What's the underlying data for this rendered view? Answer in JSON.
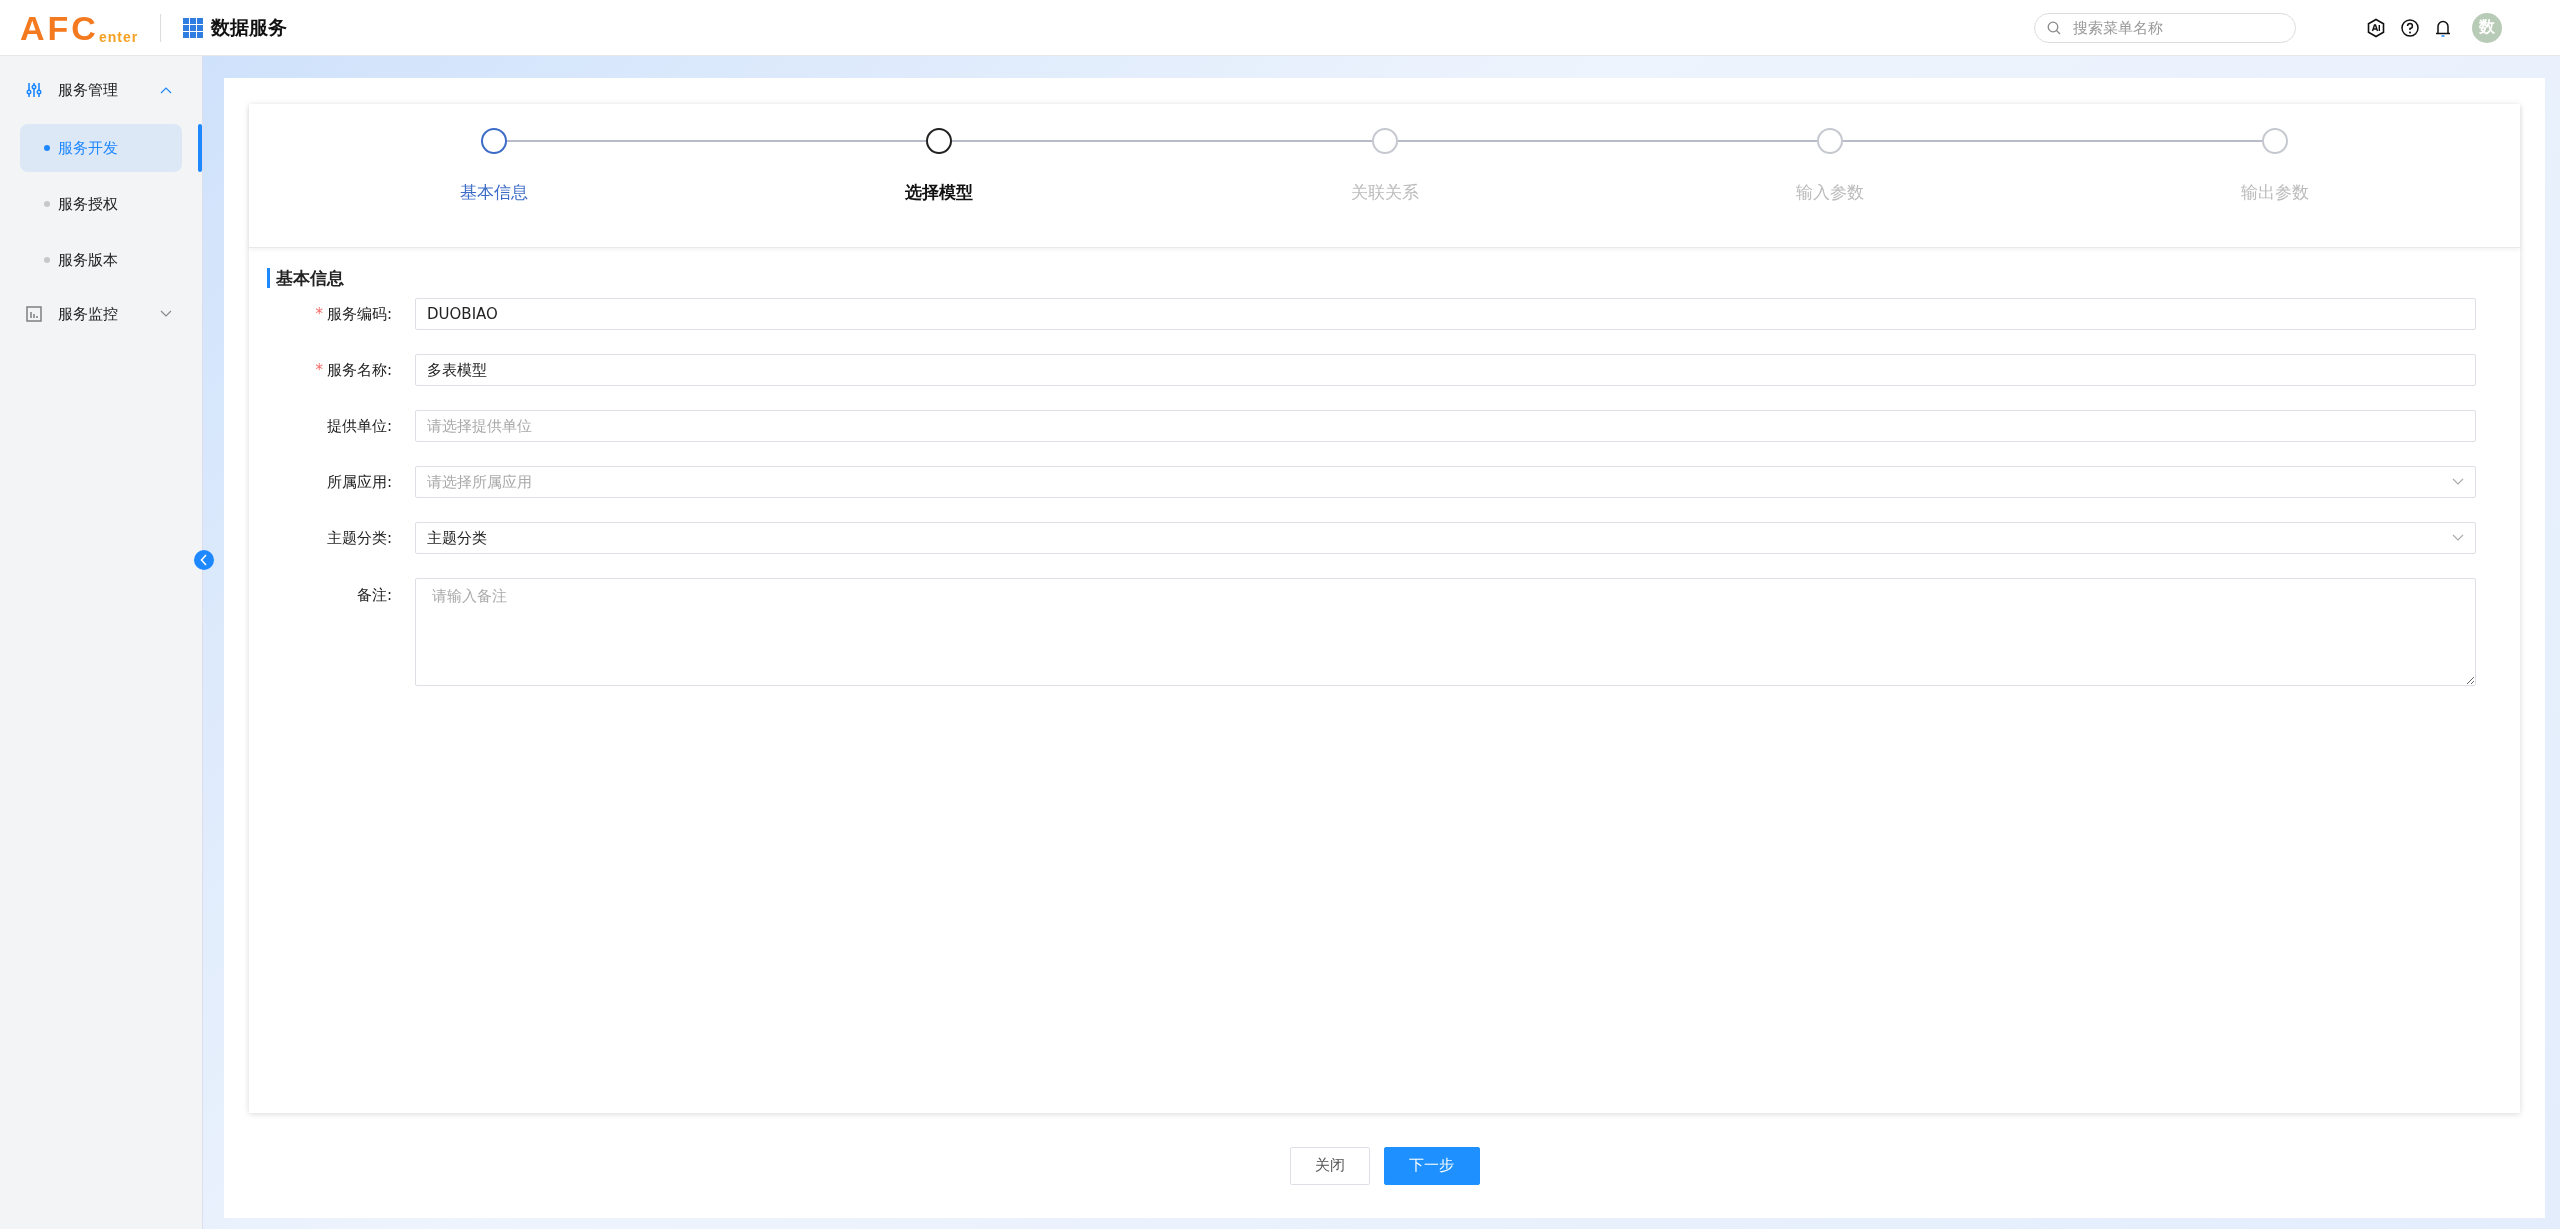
{
  "header": {
    "logo_main": "AFC",
    "logo_sub": "enter",
    "app_title": "数据服务",
    "search": {
      "placeholder": "搜索菜单名称"
    },
    "avatar": "数"
  },
  "sidebar": {
    "groups": [
      {
        "label": "服务管理",
        "expanded": true,
        "children": [
          {
            "label": "服务开发",
            "selected": true
          },
          {
            "label": "服务授权",
            "selected": false
          },
          {
            "label": "服务版本",
            "selected": false
          }
        ]
      },
      {
        "label": "服务监控",
        "expanded": false
      }
    ]
  },
  "steps": [
    {
      "label": "基本信息",
      "completed": true,
      "selected": false
    },
    {
      "label": "选择模型",
      "completed": false,
      "selected": true
    },
    {
      "label": "关联关系",
      "completed": false,
      "selected": false
    },
    {
      "label": "输入参数",
      "completed": false,
      "selected": false
    },
    {
      "label": "输出参数",
      "completed": false,
      "selected": false
    }
  ],
  "form": {
    "title": "基本信息",
    "fields": [
      {
        "label": "服务编码:",
        "kind": "input",
        "required_mark": "*",
        "value": "DUOBIAO"
      },
      {
        "label": "服务名称:",
        "kind": "input",
        "required_mark": "*",
        "value": "多表模型"
      },
      {
        "label": "提供单位:",
        "kind": "input",
        "placeholder": "请选择提供单位"
      },
      {
        "label": "所属应用:",
        "kind": "select",
        "placeholder": "请选择所属应用"
      },
      {
        "label": "主题分类:",
        "kind": "select",
        "value": "主题分类"
      },
      {
        "label": "备注:",
        "kind": "textarea",
        "placeholder": "请输入备注"
      }
    ]
  },
  "buttons": [
    {
      "label": "关闭",
      "kind": "default"
    },
    {
      "label": "下一步",
      "kind": "primary"
    }
  ]
}
